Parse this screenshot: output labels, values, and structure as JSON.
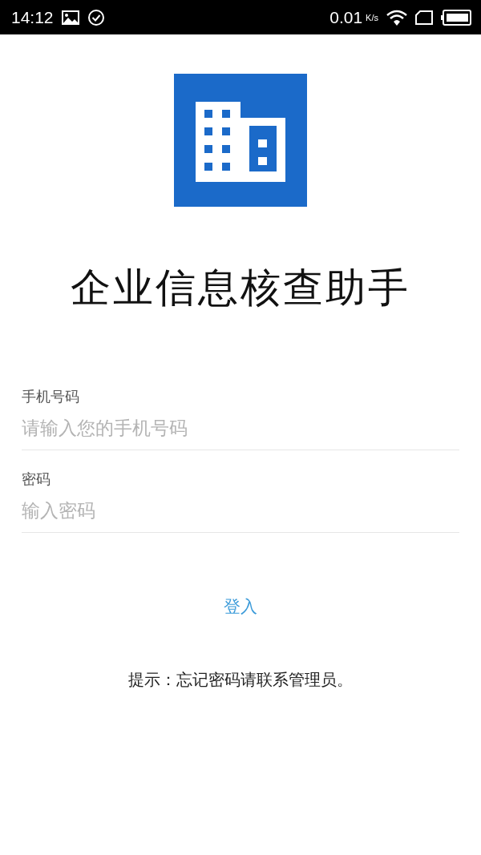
{
  "status_bar": {
    "time": "14:12",
    "speed": "0.01",
    "speed_unit": "K/s"
  },
  "app": {
    "title": "企业信息核查助手"
  },
  "fields": [
    {
      "label": "手机号码",
      "placeholder": "请输入您的手机号码"
    },
    {
      "label": "密码",
      "placeholder": "输入密码"
    }
  ],
  "login_button": "登入",
  "hint": "提示：忘记密码请联系管理员。"
}
